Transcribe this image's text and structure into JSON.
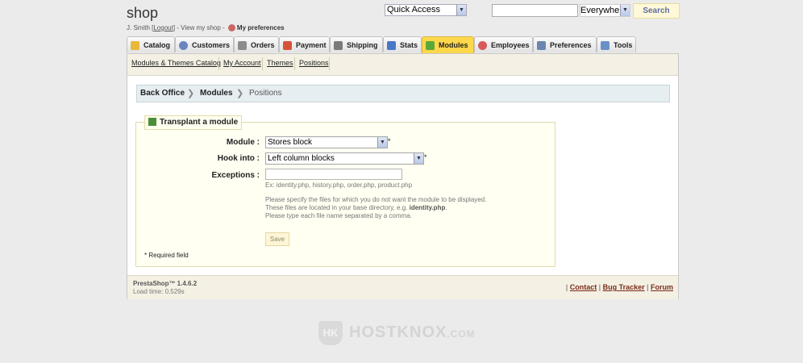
{
  "header": {
    "shop_name": "shop",
    "user_name": "J. Smith [",
    "logout_label": "Logout",
    "user_after_logout": "] - ",
    "view_shop_label": "View my shop",
    "sep": " - ",
    "my_preferences_label": "My preferences",
    "quick_access_label": "Quick Access",
    "search_scope": "Everywhere",
    "search_button": "Search",
    "search_value": ""
  },
  "tabs": [
    {
      "label": "Catalog",
      "icon": "folder-icon",
      "color": "#e8b83a"
    },
    {
      "label": "Customers",
      "icon": "user-icon",
      "color": "#6a86c0"
    },
    {
      "label": "Orders",
      "icon": "cart-icon",
      "color": "#8c8c8c"
    },
    {
      "label": "Payment",
      "icon": "payment-icon",
      "color": "#d6533a"
    },
    {
      "label": "Shipping",
      "icon": "truck-icon",
      "color": "#7a7a7a"
    },
    {
      "label": "Stats",
      "icon": "chart-icon",
      "color": "#4a78c8"
    },
    {
      "label": "Modules",
      "icon": "puzzle-icon",
      "color": "#5aa83a"
    },
    {
      "label": "Employees",
      "icon": "employee-icon",
      "color": "#d85a5a"
    },
    {
      "label": "Preferences",
      "icon": "preferences-icon",
      "color": "#6a86b0"
    },
    {
      "label": "Tools",
      "icon": "tools-icon",
      "color": "#6a90c8"
    }
  ],
  "active_tab": "Modules",
  "subnav": [
    {
      "label": "Modules & Themes Catalog"
    },
    {
      "label": "My Account"
    },
    {
      "label": "Themes"
    },
    {
      "label": "Positions"
    }
  ],
  "breadcrumb": {
    "back_office": "Back Office",
    "modules": "Modules",
    "current": "Positions"
  },
  "form": {
    "legend": "Transplant a module",
    "module_label": "Module :",
    "module_value": "Stores block",
    "hook_label": "Hook into :",
    "hook_value": "Left column blocks",
    "exceptions_label": "Exceptions :",
    "exceptions_value": "",
    "required_star": "*",
    "example_hint": "Ex: identity.php, history.php, order.php, product.php",
    "help_line1": "Please specify the files for which you do not want the module to be displayed.",
    "help_line2_prefix": "These files are located in your base directory, e.g. ",
    "help_line2_bold": "identity.php",
    "help_line2_suffix": ".",
    "help_line3": "Please type each file name separated by a comma.",
    "save_label": "Save",
    "required_note": "* Required field"
  },
  "footer": {
    "version": "PrestaShop™ 1.4.6.2",
    "load_time": "Load time: 0.529s",
    "sep": "|",
    "contact": "Contact",
    "bug_tracker": "Bug Tracker",
    "forum": "Forum"
  },
  "watermark": {
    "shield": "HK",
    "brand": "HOSTKNOX",
    "tld": ".COM"
  }
}
